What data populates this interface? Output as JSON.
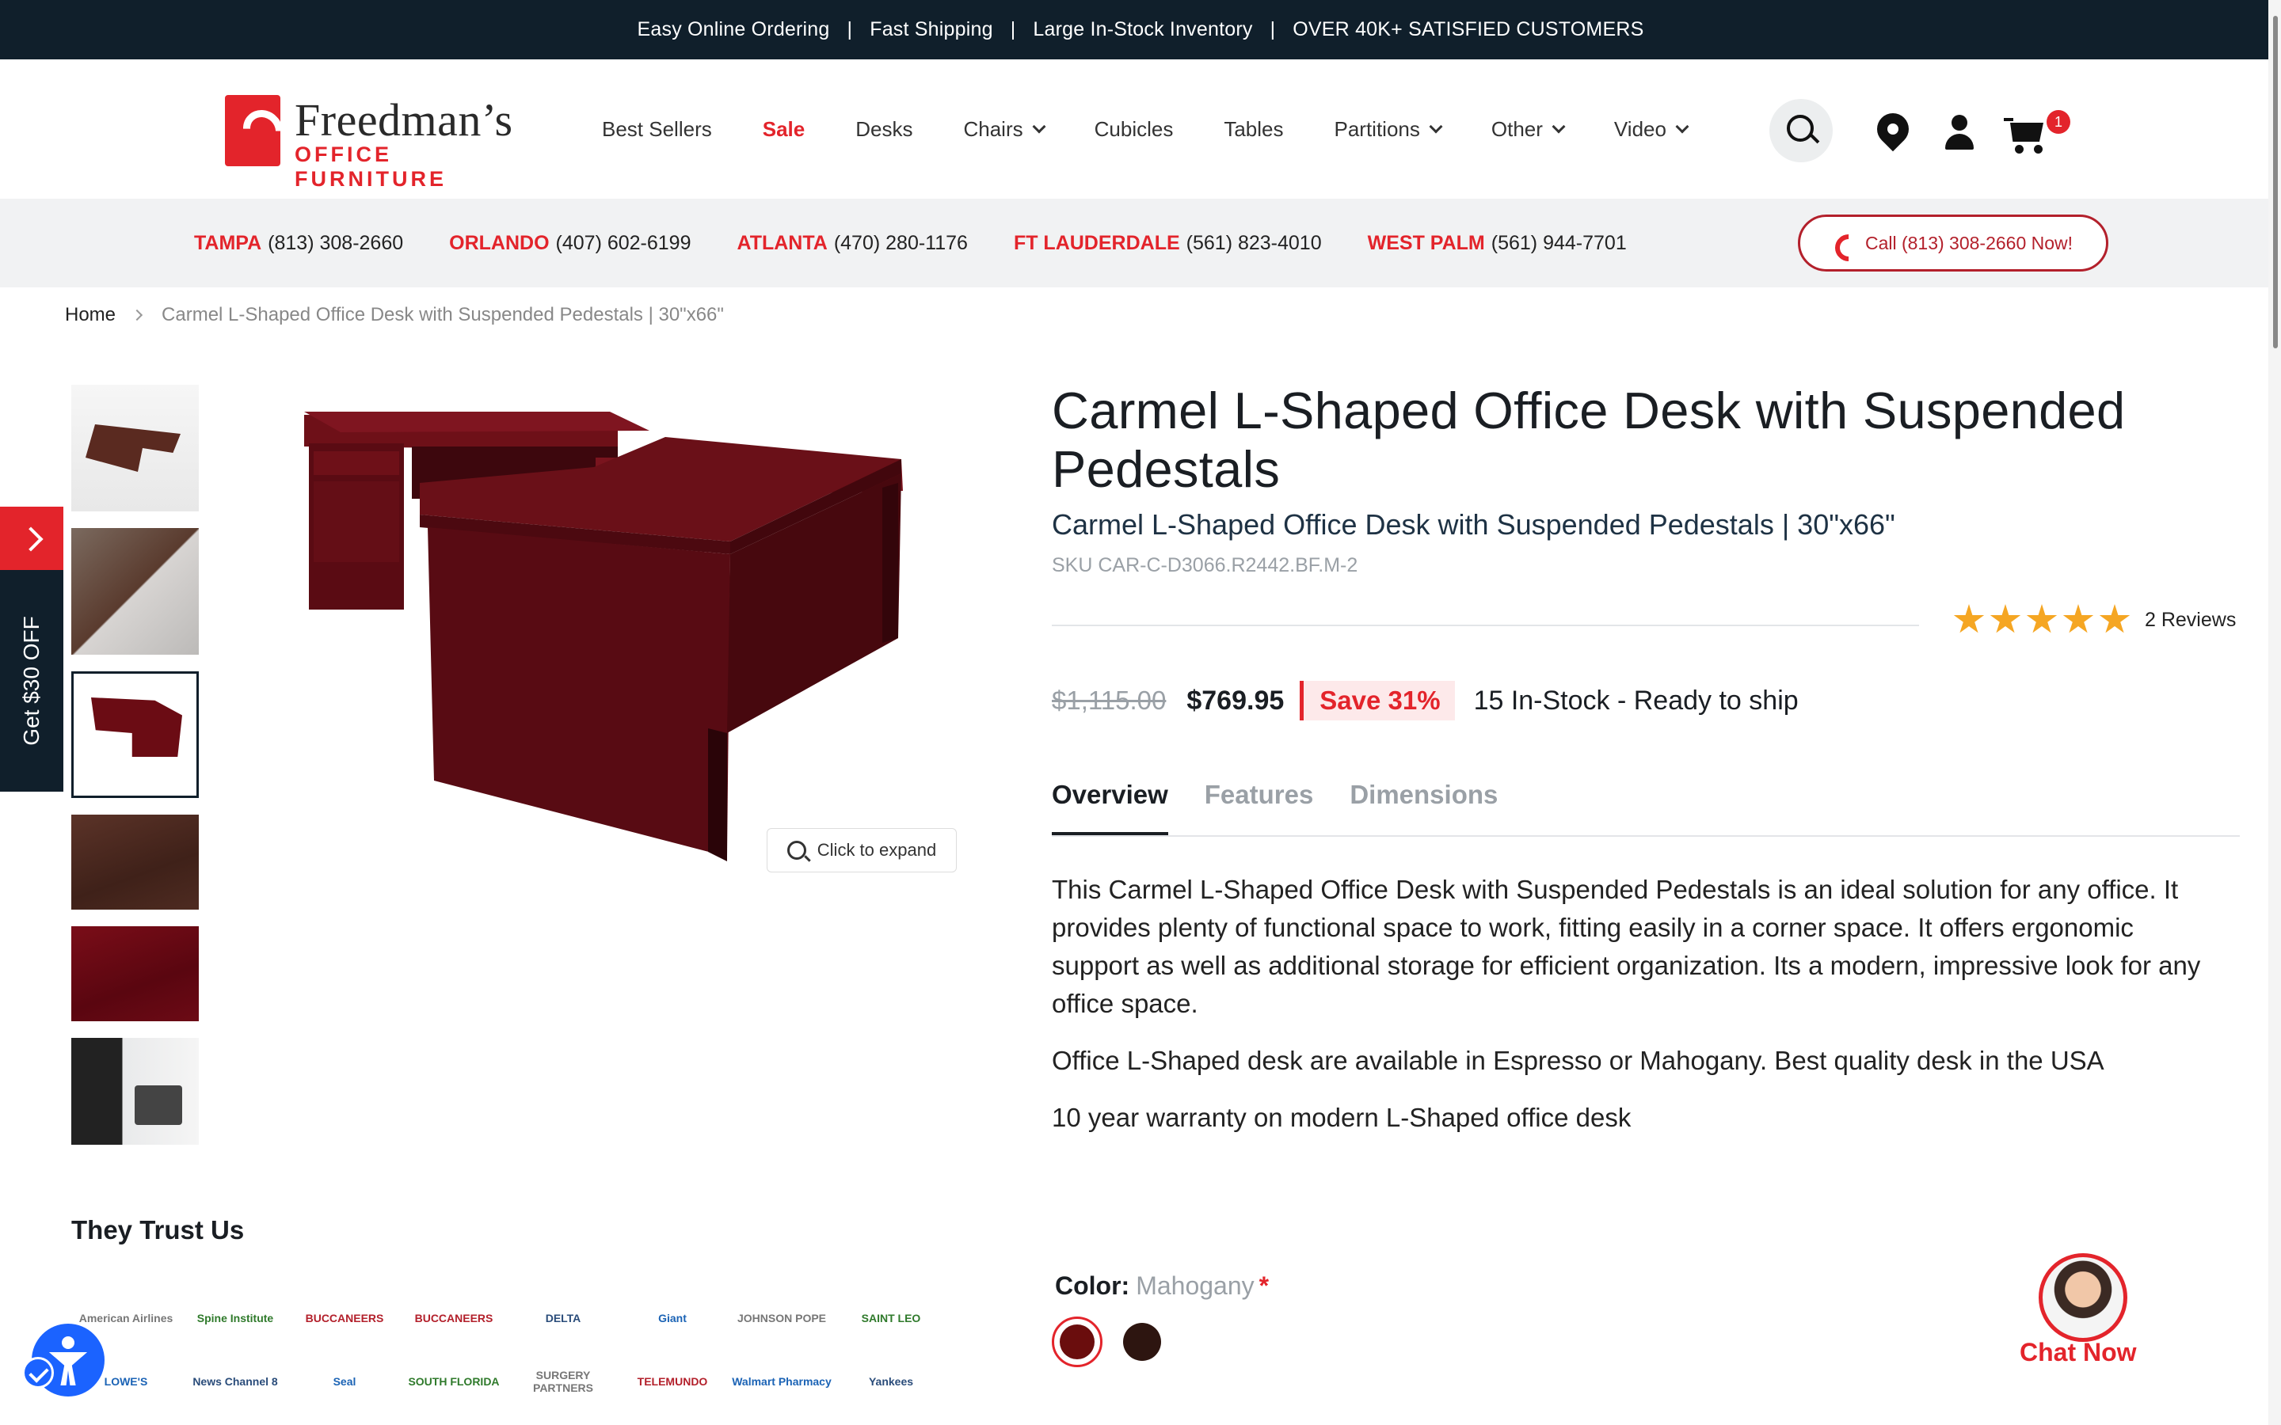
{
  "promo": {
    "items": [
      "Easy Online Ordering",
      "Fast Shipping",
      "Large In-Stock Inventory",
      "OVER 40K+ SATISFIED CUSTOMERS"
    ],
    "separator": "|"
  },
  "brand": {
    "name": "Freedman’s",
    "subtitle": "OFFICE FURNITURE",
    "accent": "#e3242b",
    "dark": "#101f2b"
  },
  "nav": {
    "items": [
      {
        "label": "Best Sellers"
      },
      {
        "label": "Sale"
      },
      {
        "label": "Desks"
      },
      {
        "label": "Chairs"
      },
      {
        "label": "Cubicles"
      },
      {
        "label": "Tables"
      },
      {
        "label": "Partitions"
      },
      {
        "label": "Other"
      },
      {
        "label": "Video"
      }
    ],
    "cart_count": "1"
  },
  "locations": [
    {
      "city": "TAMPA",
      "phone": "(813) 308-2660"
    },
    {
      "city": "ORLANDO",
      "phone": "(407) 602-6199"
    },
    {
      "city": "ATLANTA",
      "phone": "(470) 280-1176"
    },
    {
      "city": "FT LAUDERDALE",
      "phone": "(561) 823-4010"
    },
    {
      "city": "WEST PALM",
      "phone": "(561) 944-7701"
    }
  ],
  "call_button": "Call (813) 308-2660 Now!",
  "breadcrumb": {
    "home": "Home",
    "current": "Carmel L-Shaped Office Desk with Suspended Pedestals | 30\"x66\""
  },
  "side_promo": "Get $30 OFF",
  "gallery": {
    "expand_label": "Click to expand"
  },
  "product": {
    "title": "Carmel L-Shaped Office Desk with Suspended Pedestals",
    "subtitle": "Carmel L-Shaped Office Desk with Suspended Pedestals | 30\"x66\"",
    "sku": "SKU CAR-C-D3066.R2442.BF.M-2",
    "rating": 5,
    "reviews": "2 Reviews",
    "old_price": "$1,115.00",
    "price": "$769.95",
    "save": "Save 31%",
    "stock": "15 In-Stock - Ready to ship"
  },
  "tabs": [
    {
      "label": "Overview"
    },
    {
      "label": "Features"
    },
    {
      "label": "Dimensions"
    }
  ],
  "description": [
    "This Carmel L-Shaped Office Desk with Suspended Pedestals is an ideal solution for any office. It provides plenty of functional space to work, fitting easily in a corner space. It offers ergonomic support as well as additional storage for efficient organization. Its a modern, impressive look for any office space.",
    "Office L-Shaped desk are available in Espresso or Mahogany. Best quality desk in the USA",
    "10 year warranty on modern L-Shaped office desk"
  ],
  "trust": {
    "title": "They Trust Us",
    "logos": [
      "American Airlines",
      "Spine Institute",
      "BUCCANEERS",
      "BUCCANEERS",
      "DELTA",
      "Giant",
      "JOHNSON POPE",
      "SAINT LEO",
      "LOWE'S",
      "News Channel 8",
      "Seal",
      "SOUTH FLORIDA",
      "SURGERY PARTNERS",
      "TELEMUNDO",
      "Walmart Pharmacy",
      "Yankees"
    ]
  },
  "color": {
    "label": "Color:",
    "value": "Mahogany",
    "required": "*",
    "swatches": [
      "#6a0d0d",
      "#2d1510"
    ]
  },
  "chat": {
    "label": "Chat Now"
  }
}
